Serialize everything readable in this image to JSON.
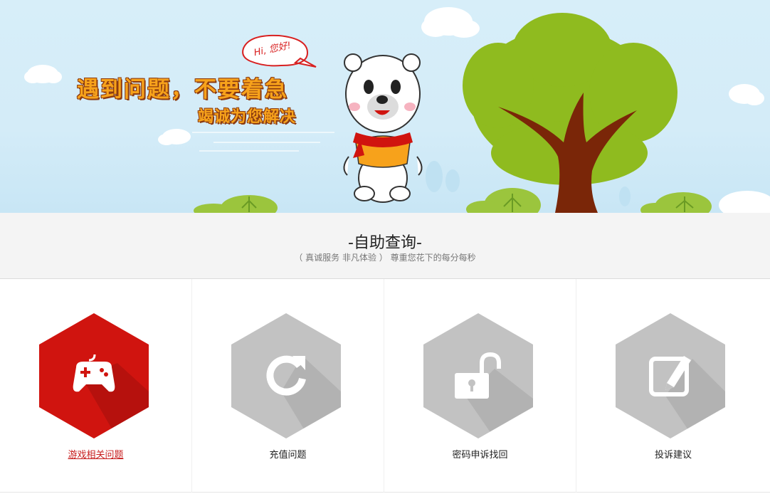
{
  "banner": {
    "speech_bubble": "Hi, 您好!",
    "headline": "遇到问题，不要着急",
    "subline": "竭诚为您解决"
  },
  "section": {
    "title": "-自助查询-",
    "subtitle": "（ 真诚服务 非凡体验 ） 尊重您花下的每分每秒"
  },
  "cards": [
    {
      "label": "游戏相关问题",
      "icon": "gamepad-icon",
      "active": true,
      "color": "#d0140f"
    },
    {
      "label": "充值问题",
      "icon": "refresh-icon",
      "active": false,
      "color": "#c2c2c2"
    },
    {
      "label": "密码申诉找回",
      "icon": "unlock-icon",
      "active": false,
      "color": "#c2c2c2"
    },
    {
      "label": "投诉建议",
      "icon": "edit-icon",
      "active": false,
      "color": "#c2c2c2"
    }
  ]
}
